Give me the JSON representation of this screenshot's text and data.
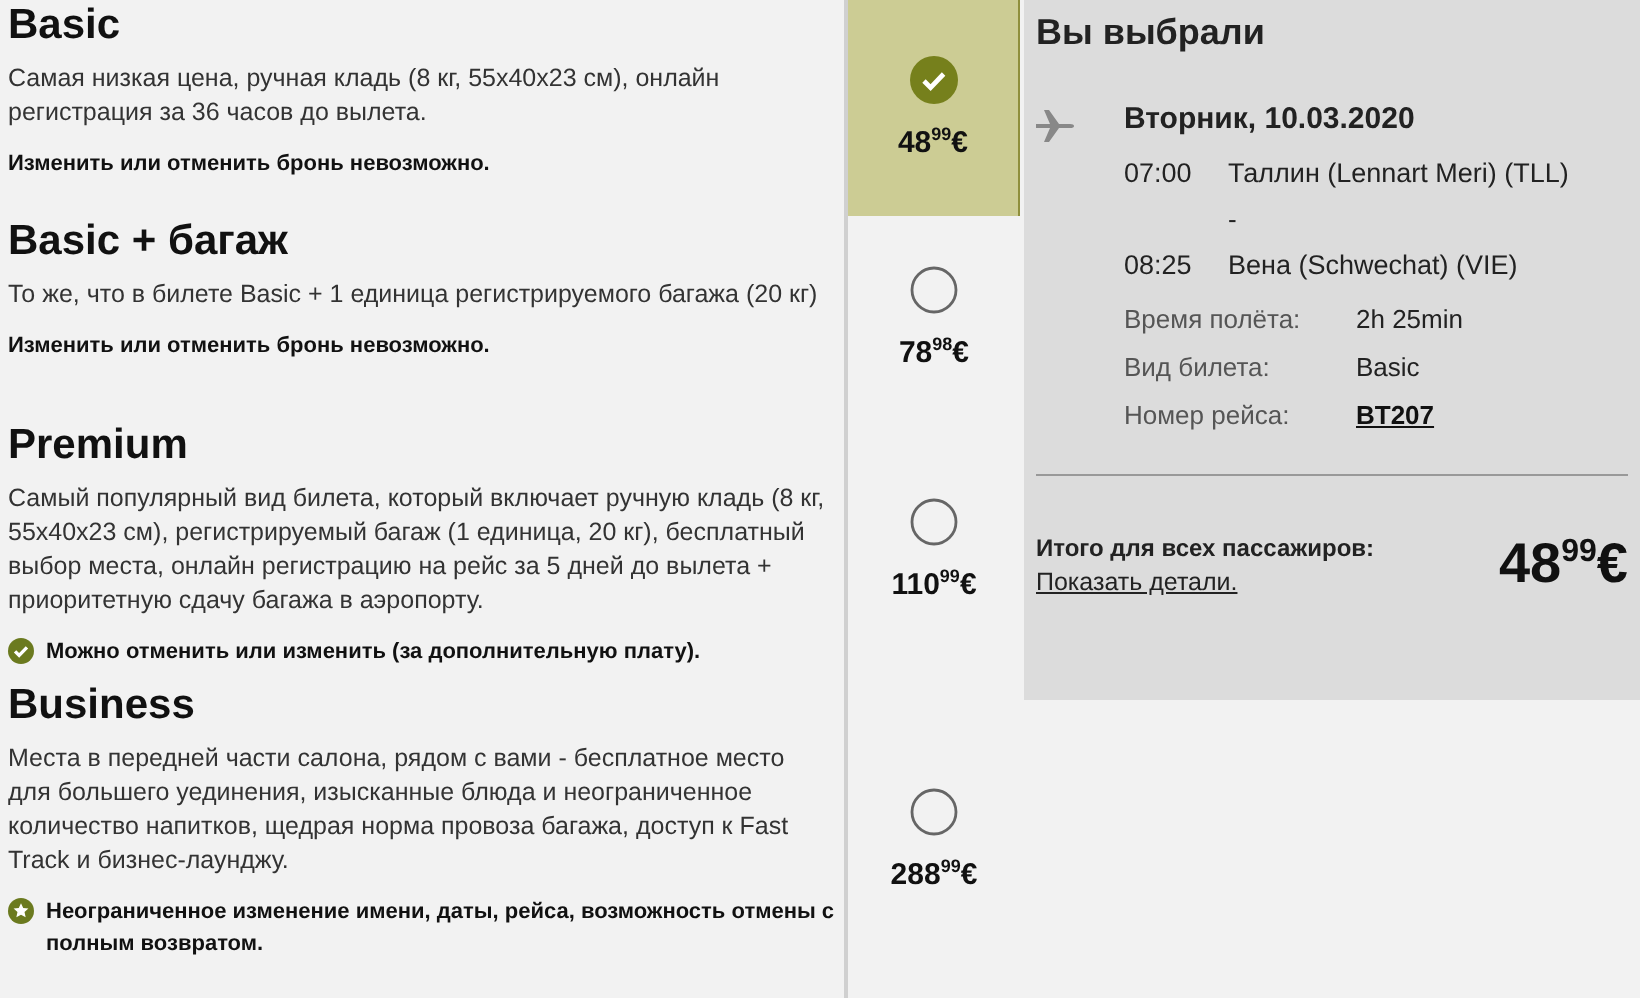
{
  "fares": [
    {
      "name": "Basic",
      "description": "Самая низкая цена, ручная кладь (8 кг, 55x40x23 см), онлайн регистрация за 36 часов до вылета.",
      "note": "Изменить или отменить бронь невозможно.",
      "kind": "plain",
      "price": "48$^{99}$€",
      "selected": true
    },
    {
      "name": "Basic + багаж",
      "description": "То же, что в билете Basic + 1 единица регистрируемого багажа (20 кг)",
      "note": "Изменить или отменить бронь невозможно.",
      "kind": "plain",
      "price": "78$^{98}$€",
      "selected": false
    },
    {
      "name": "Premium",
      "description": "Самый популярный вид билета, который включает ручную кладь (8 кг, 55x40x23 см), регистрируемый багаж (1 единица, 20 кг), бесплатный выбор места, онлайн регистрацию на рейс за 5 дней до вылета + приоритетную сдачу багажа в аэропорту.",
      "note": "Можно отменить или изменить (за дополнительную плату).",
      "kind": "check",
      "price": "110$^{99}$€",
      "selected": false
    },
    {
      "name": "Business",
      "description": "Места в передней части салона, рядом с вами - бесплатное место для большего уединения, изысканные блюда и неограниченное количество напитков, щедрая норма провоза багажа, доступ к Fast Track и бизнес-лаунджу.",
      "note": "Неограниченное изменение имени, даты, рейса, возможность отмены с полным возвратом.",
      "kind": "star",
      "price": "288$^{99}$€",
      "selected": false
    }
  ],
  "summary": {
    "title": "Вы выбрали",
    "date": "Вторник, 10.03.2020",
    "departure": {
      "time": "07:00",
      "place": "Таллин (Lennart Meri) (TLL)"
    },
    "separator": "-",
    "arrival": {
      "time": "08:25",
      "place": "Вена (Schwechat) (VIE)"
    },
    "details": [
      {
        "label": "Время полёта:",
        "value": "2h 25min",
        "kind": "text"
      },
      {
        "label": "Вид билета:",
        "value": "Basic",
        "kind": "text"
      },
      {
        "label": "Номер рейса:",
        "value": "BT207",
        "kind": "link"
      }
    ],
    "total_label": "Итого для всех пассажиров:",
    "details_link": "Показать детали.",
    "total": "48$^{99}$€"
  }
}
